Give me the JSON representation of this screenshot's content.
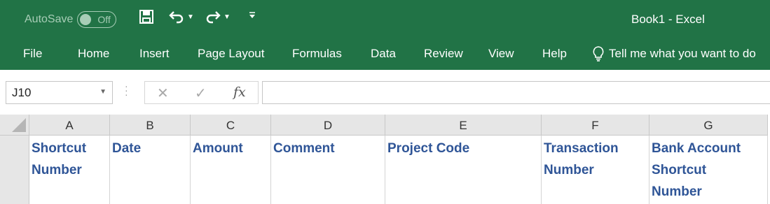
{
  "titlebar": {
    "autosave_label": "AutoSave",
    "autosave_state": "Off",
    "doc_title": "Book1  -  Excel",
    "qat_icons": [
      "save-icon",
      "undo-icon",
      "redo-icon",
      "customize-qat-icon"
    ]
  },
  "ribbon": {
    "tabs": [
      "File",
      "Home",
      "Insert",
      "Page Layout",
      "Formulas",
      "Data",
      "Review",
      "View",
      "Help"
    ],
    "tell_me": "Tell me what you want to do"
  },
  "formula_bar": {
    "name_box": "J10",
    "cancel_glyph": "✕",
    "enter_glyph": "✓",
    "fx_label": "fx",
    "formula": ""
  },
  "grid": {
    "columns": [
      "A",
      "B",
      "C",
      "D",
      "E",
      "F",
      "G"
    ],
    "row1": [
      [
        "Shortcut",
        "Number"
      ],
      [
        "Date"
      ],
      [
        "Amount"
      ],
      [
        "Comment"
      ],
      [
        "Project Code"
      ],
      [
        "Transaction",
        "Number"
      ],
      [
        "Bank Account",
        "Shortcut",
        "Number"
      ]
    ]
  },
  "colors": {
    "excel_green": "#217346",
    "header_text": "#2f5597"
  }
}
